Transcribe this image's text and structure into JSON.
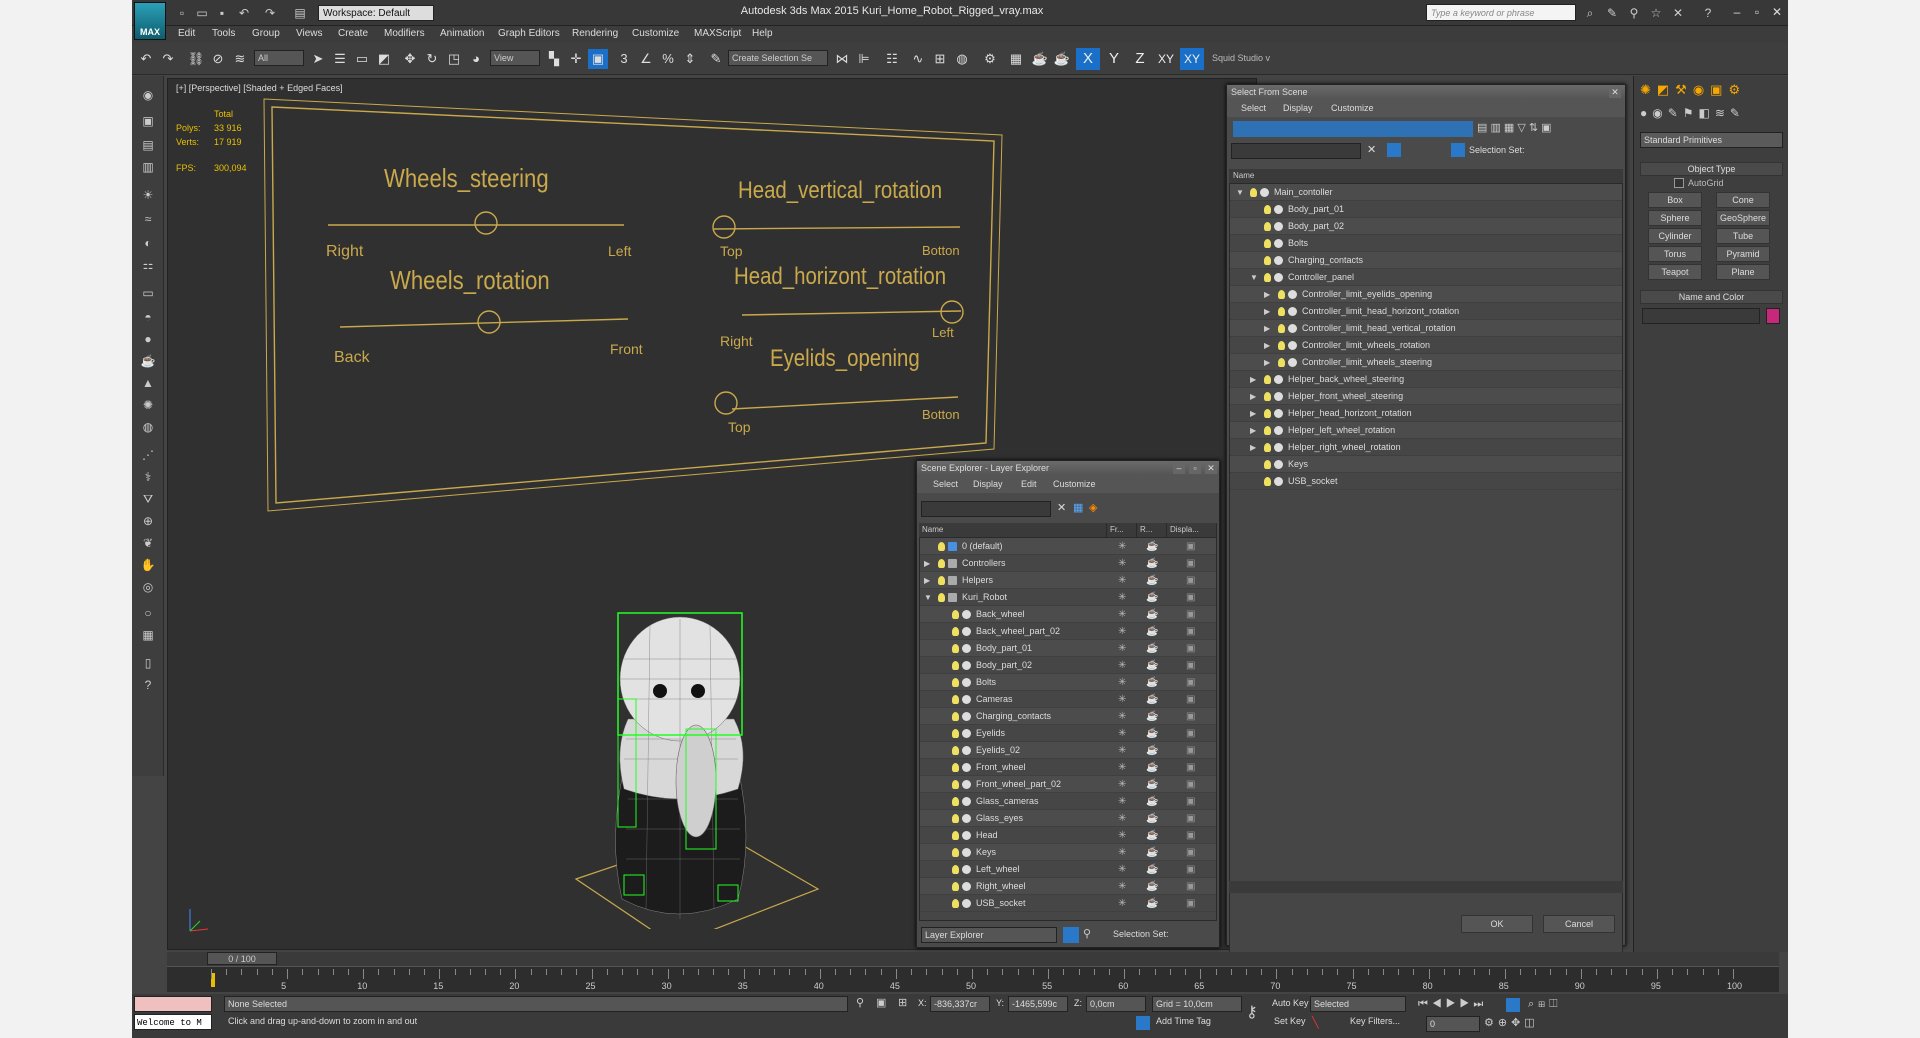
{
  "titlebar": {
    "logo": "MAX",
    "workspace": "Workspace: Default",
    "title": "Autodesk 3ds Max  2015     Kuri_Home_Robot_Rigged_vray.max",
    "keyword_placeholder": "Type a keyword or phrase"
  },
  "menu": [
    "Edit",
    "Tools",
    "Group",
    "Views",
    "Create",
    "Modifiers",
    "Animation",
    "Graph Editors",
    "Rendering",
    "Customize",
    "MAXScript",
    "Help"
  ],
  "toolbar": {
    "filter": "All",
    "view": "View",
    "selection_set": "Create Selection Se",
    "axes": [
      "X",
      "Y",
      "Z",
      "XY",
      "XY"
    ],
    "user": "Squid Studio v"
  },
  "viewport": {
    "label": "[+] [Perspective] [Shaded + Edged Faces]",
    "stats": {
      "total": "Total",
      "polys_label": "Polys:",
      "polys": "33 916",
      "verts_label": "Verts:",
      "verts": "17 919",
      "fps_label": "FPS:",
      "fps": "300,094"
    }
  },
  "controller_board": {
    "labels": [
      "Wheels_steering",
      "Head_vertical_rotation",
      "Wheels_rotation",
      "Head_horizont_rotation",
      "Eyelids_opening"
    ],
    "sub": [
      "Right",
      "Left",
      "Top",
      "Botton",
      "Back",
      "Front",
      "Right",
      "Left",
      "Top",
      "Botton"
    ]
  },
  "select_from_scene": {
    "title": "Select From Scene",
    "menus": [
      "Select",
      "Display",
      "Customize"
    ],
    "selection_set_label": "Selection Set:",
    "col_name": "Name",
    "rows": [
      {
        "label": "Main_contoller",
        "level": 0,
        "exp": "open"
      },
      {
        "label": "Body_part_01",
        "level": 1,
        "exp": ""
      },
      {
        "label": "Body_part_02",
        "level": 1,
        "exp": ""
      },
      {
        "label": "Bolts",
        "level": 1,
        "exp": ""
      },
      {
        "label": "Charging_contacts",
        "level": 1,
        "exp": ""
      },
      {
        "label": "Controller_panel",
        "level": 1,
        "exp": "open"
      },
      {
        "label": "Controller_limit_eyelids_opening",
        "level": 2,
        "exp": "closed"
      },
      {
        "label": "Controller_limit_head_horizont_rotation",
        "level": 2,
        "exp": "closed"
      },
      {
        "label": "Controller_limit_head_vertical_rotation",
        "level": 2,
        "exp": "closed"
      },
      {
        "label": "Controller_limit_wheels_rotation",
        "level": 2,
        "exp": "closed"
      },
      {
        "label": "Controller_limit_wheels_steering",
        "level": 2,
        "exp": "closed"
      },
      {
        "label": "Helper_back_wheel_steering",
        "level": 1,
        "exp": "closed"
      },
      {
        "label": "Helper_front_wheel_steering",
        "level": 1,
        "exp": "closed"
      },
      {
        "label": "Helper_head_horizont_rotation",
        "level": 1,
        "exp": "closed"
      },
      {
        "label": "Helper_left_wheel_rotation",
        "level": 1,
        "exp": "closed"
      },
      {
        "label": "Helper_right_wheel_rotation",
        "level": 1,
        "exp": "closed"
      },
      {
        "label": "Keys",
        "level": 1,
        "exp": ""
      },
      {
        "label": "USB_socket",
        "level": 1,
        "exp": ""
      }
    ],
    "ok": "OK",
    "cancel": "Cancel"
  },
  "layer_explorer": {
    "title": "Scene Explorer - Layer Explorer",
    "menus": [
      "Select",
      "Display",
      "Edit",
      "Customize"
    ],
    "cols": [
      "Name",
      "Fr...",
      "R...",
      "Displa..."
    ],
    "rows": [
      {
        "label": "0 (default)",
        "level": 0,
        "exp": "",
        "layer": true
      },
      {
        "label": "Controllers",
        "level": 0,
        "exp": "closed",
        "layer": true
      },
      {
        "label": "Helpers",
        "level": 0,
        "exp": "closed",
        "layer": true
      },
      {
        "label": "Kuri_Robot",
        "level": 0,
        "exp": "open",
        "layer": true
      },
      {
        "label": "Back_wheel",
        "level": 1,
        "exp": "",
        "layer": false
      },
      {
        "label": "Back_wheel_part_02",
        "level": 1,
        "exp": "",
        "layer": false
      },
      {
        "label": "Body_part_01",
        "level": 1,
        "exp": "",
        "layer": false
      },
      {
        "label": "Body_part_02",
        "level": 1,
        "exp": "",
        "layer": false
      },
      {
        "label": "Bolts",
        "level": 1,
        "exp": "",
        "layer": false
      },
      {
        "label": "Cameras",
        "level": 1,
        "exp": "",
        "layer": false
      },
      {
        "label": "Charging_contacts",
        "level": 1,
        "exp": "",
        "layer": false
      },
      {
        "label": "Eyelids",
        "level": 1,
        "exp": "",
        "layer": false
      },
      {
        "label": "Eyelids_02",
        "level": 1,
        "exp": "",
        "layer": false
      },
      {
        "label": "Front_wheel",
        "level": 1,
        "exp": "",
        "layer": false
      },
      {
        "label": "Front_wheel_part_02",
        "level": 1,
        "exp": "",
        "layer": false
      },
      {
        "label": "Glass_cameras",
        "level": 1,
        "exp": "",
        "layer": false
      },
      {
        "label": "Glass_eyes",
        "level": 1,
        "exp": "",
        "layer": false
      },
      {
        "label": "Head",
        "level": 1,
        "exp": "",
        "layer": false
      },
      {
        "label": "Keys",
        "level": 1,
        "exp": "",
        "layer": false
      },
      {
        "label": "Left_wheel",
        "level": 1,
        "exp": "",
        "layer": false
      },
      {
        "label": "Right_wheel",
        "level": 1,
        "exp": "",
        "layer": false
      },
      {
        "label": "USB_socket",
        "level": 1,
        "exp": "",
        "layer": false
      }
    ],
    "footer": "Layer Explorer",
    "selection_set_label": "Selection Set:"
  },
  "command_panel": {
    "dropdown": "Standard Primitives",
    "object_type": "Object Type",
    "autogrid": "AutoGrid",
    "buttons": [
      "Box",
      "Cone",
      "Sphere",
      "GeoSphere",
      "Cylinder",
      "Tube",
      "Torus",
      "Pyramid",
      "Teapot",
      "Plane"
    ],
    "name_color": "Name and Color",
    "swatch": "#c8287a"
  },
  "timeline": {
    "frame": "0 / 100",
    "ticks": [
      "5",
      "10",
      "15",
      "20",
      "25",
      "30",
      "35",
      "40",
      "45",
      "50",
      "55",
      "60",
      "65",
      "70",
      "75",
      "80",
      "85",
      "90",
      "95",
      "100"
    ]
  },
  "status": {
    "listener": "Welcome to M",
    "selection": "None Selected",
    "prompt": "Click and drag up-and-down to zoom in and out",
    "x_label": "X:",
    "x": "-836,337cr",
    "y_label": "Y:",
    "y": "-1465,599c",
    "z_label": "Z:",
    "z": "0,0cm",
    "grid": "Grid = 10,0cm",
    "add_time_tag": "Add Time Tag",
    "auto_key": "Auto Key",
    "set_key": "Set Key",
    "key_mode": "Selected",
    "key_filters": "Key Filters...",
    "frame_field": "0"
  }
}
